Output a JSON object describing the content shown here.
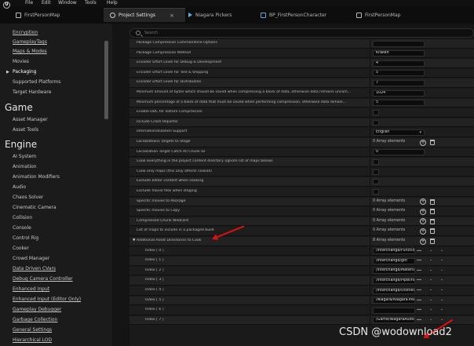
{
  "menu": [
    "File",
    "Edit",
    "Window",
    "Tools",
    "Help"
  ],
  "tabs": [
    {
      "label": "FirstPersonMap",
      "active": false
    },
    {
      "label": "Project Settings",
      "active": true
    },
    {
      "label": "Niagara Pickers",
      "active": false
    },
    {
      "label": "BP_FirstPersonCharacter",
      "active": false
    },
    {
      "label": "FirstPersonMap",
      "active": false
    }
  ],
  "sidebar": {
    "items_top": [
      {
        "label": "Encryption"
      },
      {
        "label": "GameplayTags"
      },
      {
        "label": "Maps & Modes"
      },
      {
        "label": "Movies"
      },
      {
        "label": "Packaging"
      },
      {
        "label": "Supported Platforms"
      },
      {
        "label": "Target Hardware"
      }
    ],
    "section_game": "Game",
    "items_game": [
      {
        "label": "Asset Manager"
      },
      {
        "label": "Asset Tools"
      }
    ],
    "section_engine": "Engine",
    "items_engine": [
      {
        "label": "AI System"
      },
      {
        "label": "Animation"
      },
      {
        "label": "Animation Modifiers"
      },
      {
        "label": "Audio"
      },
      {
        "label": "Chaos Solver"
      },
      {
        "label": "Cinematic Camera"
      },
      {
        "label": "Collision"
      },
      {
        "label": "Console"
      },
      {
        "label": "Control Rig"
      },
      {
        "label": "Cooker"
      },
      {
        "label": "Crowd Manager"
      },
      {
        "label": "Data Driven CVars"
      },
      {
        "label": "Debug Camera Controller"
      },
      {
        "label": "Enhanced Input"
      },
      {
        "label": "Enhanced Input (Editor Only)"
      },
      {
        "label": "Gameplay Debugger"
      },
      {
        "label": "Garbage Collection"
      },
      {
        "label": "General Settings"
      },
      {
        "label": "Hierarchical LOD"
      }
    ]
  },
  "search": {
    "placeholder": "Search"
  },
  "properties": [
    {
      "label": "Package Compression Commandline Options",
      "type": "text",
      "value": ""
    },
    {
      "label": "Package Compression Method",
      "type": "text",
      "value": "Kraken"
    },
    {
      "label": "Encoder Effort Level for Debug & Development",
      "type": "text",
      "value": "4"
    },
    {
      "label": "Encoder Effort Level for Test & Shipping",
      "type": "text",
      "value": "5"
    },
    {
      "label": "Encoder Effort Level for Distribution",
      "type": "text",
      "value": "7"
    },
    {
      "label": "Minimum amount of bytes which should be saved when compressing a block of data, otherwise data remains uncom...",
      "type": "text",
      "value": "1024"
    },
    {
      "label": "Minimum percentage of a block of data that must be saved when performing compression, otherwise data remain...",
      "type": "text",
      "value": "5"
    },
    {
      "label": "Enable DDC for Iostore Compression",
      "type": "check"
    },
    {
      "label": "Include Crash Reporter",
      "type": "check"
    },
    {
      "label": "Internationalization Support",
      "type": "combo",
      "value": "English"
    },
    {
      "label": "Localizations Targets to Stage",
      "type": "array",
      "value": "0 Array elements"
    },
    {
      "label": "Localization Target Catch All Chunk ID",
      "type": "text",
      "value": "0"
    },
    {
      "label": "Cook everything in the project content directory (ignore list of maps below)",
      "type": "check"
    },
    {
      "label": "Cook only maps (this only affects cookall)",
      "type": "check"
    },
    {
      "label": "Exclude editor content when cooking",
      "type": "check"
    },
    {
      "label": "Exclude movie files when staging",
      "type": "check"
    },
    {
      "label": "Specific movies to Package",
      "type": "array",
      "value": "0 Array elements"
    },
    {
      "label": "Specific movies to Copy",
      "type": "array",
      "value": "0 Array elements"
    },
    {
      "label": "Compressed Chunk Wildcard",
      "type": "array",
      "value": "0 Array elements"
    },
    {
      "label": "List of maps to include in a packaged build",
      "type": "array",
      "value": "0 Array elements"
    },
    {
      "label": "Additional Asset Directories to Cook",
      "type": "array-open",
      "value": "8 Array elements"
    },
    {
      "label": "Index [ 0 ]",
      "type": "path",
      "value": "/Interchange/Functions"
    },
    {
      "label": "Index [ 1 ]",
      "type": "path",
      "value": "/Interchange/gltf"
    },
    {
      "label": "Index [ 2 ]",
      "type": "path",
      "value": "/Interchange/Materials"
    },
    {
      "label": "Index [ 3 ]",
      "type": "path",
      "value": "/Interchange/Pipelines"
    },
    {
      "label": "Index [ 4 ]",
      "type": "path",
      "value": "/Interchange/Utilities"
    },
    {
      "label": "Index [ 5 ]",
      "type": "path",
      "value": "/Niagara/NiagaraTree"
    },
    {
      "label": "Index [ 6 ]",
      "type": "path",
      "value": ""
    },
    {
      "label": "Index [ 7 ]",
      "type": "path",
      "value": "/Game/NiagaraAudio"
    }
  ],
  "watermark": "CSDN @wodownload2",
  "colors": {
    "annotation": "#e01010",
    "background": "#151515"
  }
}
